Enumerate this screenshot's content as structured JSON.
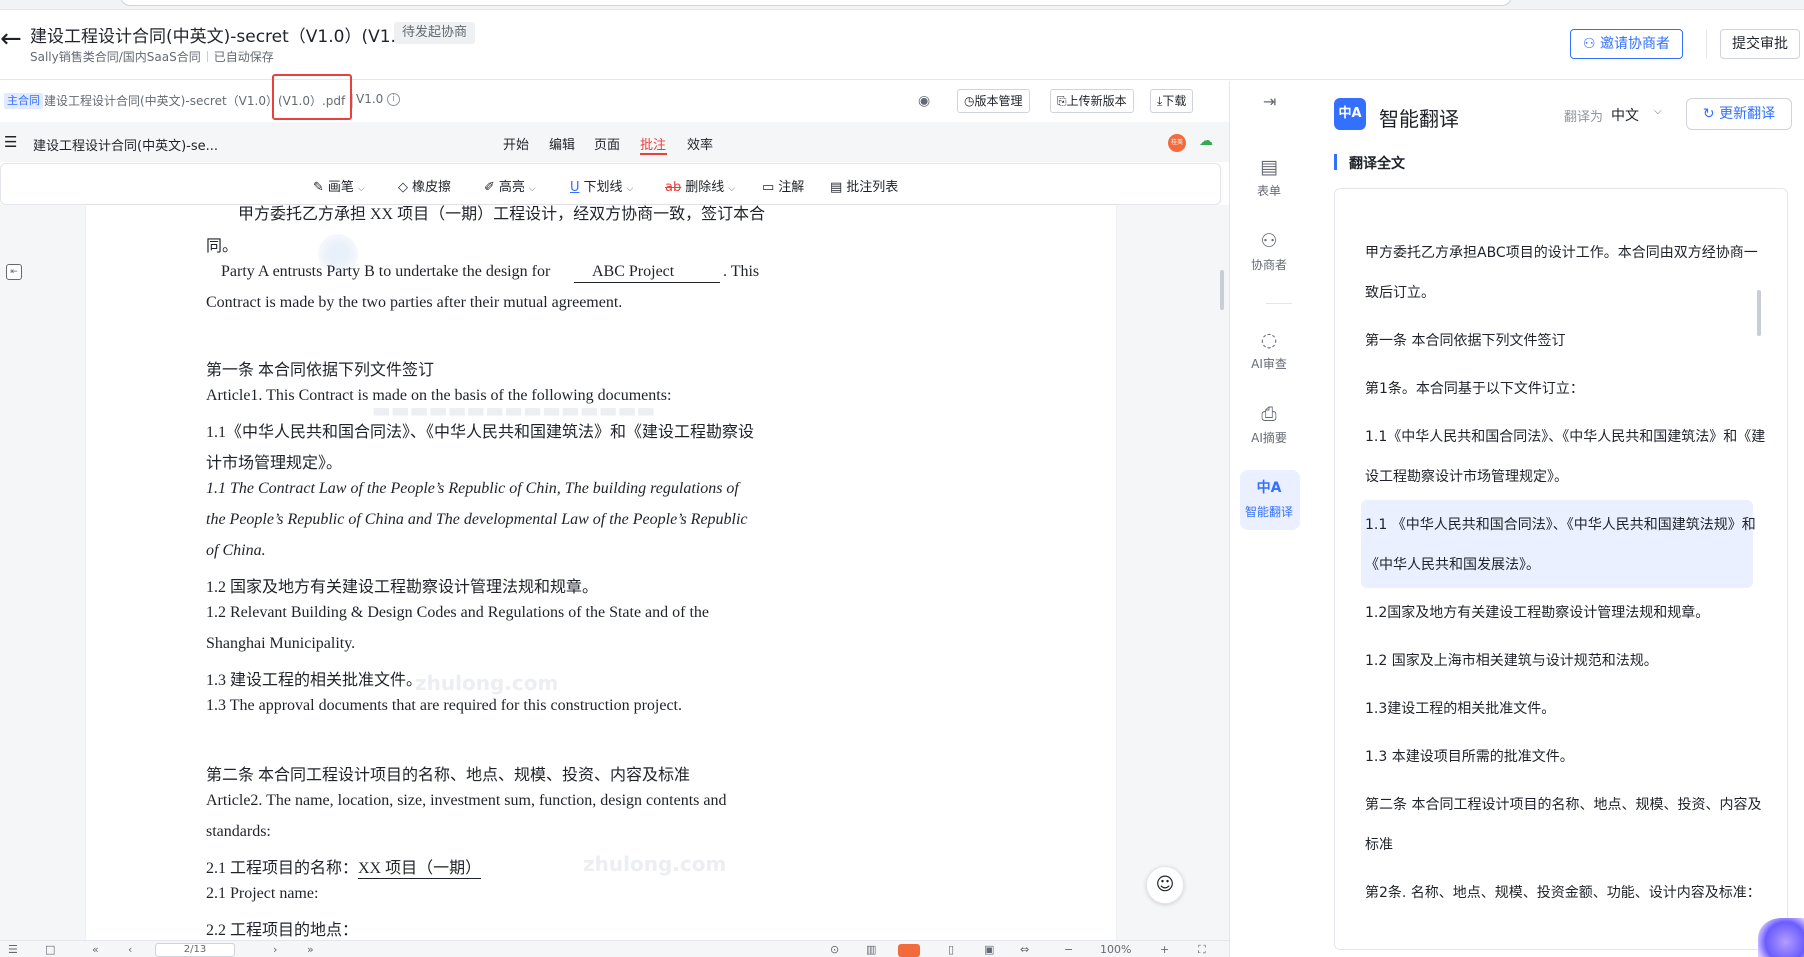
{
  "header": {
    "back_icon": "←",
    "title": "建设工程设计合同(中英文)-secret（V1.0）(V1.0)",
    "status_tag": "待发起协商",
    "breadcrumb": "Sally销售类合同/国内SaaS合同",
    "autosave": "已自动保存",
    "invite_button": "邀请协商者",
    "submit_button": "提交审批"
  },
  "file_bar": {
    "main_badge": "主合同",
    "file_name": "建设工程设计合同(中英文)-secret（V1.0）",
    "file_suffix": "(V1.0）.pdf",
    "version": "V1.0",
    "version_mgmt": "版本管理",
    "upload_new": "上传新版本",
    "download": "下载"
  },
  "menubar": {
    "doc_title": "建设工程设计合同(中英文)-se...",
    "tabs": [
      "开始",
      "编辑",
      "页面",
      "批注",
      "效率"
    ],
    "active_tab": "批注",
    "avatar_text": "桂英"
  },
  "annotation_tools": {
    "pen": "画笔",
    "eraser": "橡皮擦",
    "highlight": "高亮",
    "underline": "下划线",
    "strikeout": "删除线",
    "note": "注解",
    "comment_list": "批注列表"
  },
  "document": {
    "lines": [
      "甲方委托乙方承担 XX 项目（一期）工程设计，经双方协商一致，签订本合",
      "同。",
      "Party A entrusts Party B to undertake the design for",
      "ABC Project",
      ". This",
      "Contract is made by the two parties after their mutual agreement.",
      "第一条    本合同依据下列文件签订",
      "Article1. This Contract is made on the basis of the following documents:",
      "1.1《中华人民共和国合同法》、《中华人民共和国建筑法》和《建设工程勘察设",
      "计市场管理规定》。",
      "1.1 The Contract Law of the People’s Republic of Chin, The building regulations of",
      "the People’s Republic of China and The developmental Law of the People’s Republic",
      "of China.",
      "1.2 国家及地方有关建设工程勘察设计管理法规和规章。",
      "1.2 Relevant Building & Design Codes and Regulations of the State and of the",
      "Shanghai Municipality.",
      "1.3 建设工程的相关批准文件。",
      "1.3 The approval documents that are required for this construction project.",
      "第二条    本合同工程设计项目的名称、地点、规模、投资、内容及标准",
      "Article2. The name, location, size, investment sum, function, design contents and",
      "standards:",
      "2.1 工程项目的名称：",
      "XX 项目（一期）",
      "2.1 Project name:",
      "2.2 工程项目的地点："
    ],
    "watermark": "zhulong.com"
  },
  "bottom_bar": {
    "page": "2/13",
    "zoom": "100%"
  },
  "rail": {
    "items": [
      {
        "label": "表单",
        "icon": "form-icon"
      },
      {
        "label": "协商者",
        "icon": "users-icon"
      },
      {
        "label": "AI审查",
        "icon": "ai-review-icon"
      },
      {
        "label": "AI摘要",
        "icon": "ai-summary-icon"
      },
      {
        "label": "智能翻译",
        "icon": "translate-icon"
      }
    ],
    "active": "智能翻译"
  },
  "panel": {
    "logo_text": "中A",
    "title": "智能翻译",
    "translate_to_label": "翻译为",
    "language": "中文",
    "update_button": "更新翻译",
    "section_title": "翻译全文",
    "lines": [
      "甲方委托乙方承担ABC项目的设计工作。本合同由双方经协商一",
      "致后订立。",
      "第一条 本合同依据下列文件签订",
      "第1条。本合同基于以下文件订立：",
      "1.1《中华人民共和国合同法》、《中华人民共和国建筑法》和《建",
      "设工程勘察设计市场管理规定》。",
      "1.1 《中华人民共和国合同法》、《中华人民共和国建筑法规》和",
      "《中华人民共和国发展法》。",
      "1.2国家及地方有关建设工程勘察设计管理法规和规章。",
      "1.2 国家及上海市相关建筑与设计规范和法规。",
      "1.3建设工程的相关批准文件。",
      "1.3 本建设项目所需的批准文件。",
      "第二条 本合同工程设计项目的名称、地点、规模、投资、内容及",
      "标准",
      "第2条. 名称、地点、规模、投资金额、功能、设计内容及标准："
    ]
  },
  "colors": {
    "accent": "#3370ff",
    "active_tab": "#e8403c",
    "highlight_box": "#e8403c",
    "highlight_row": "#eaf0ff"
  }
}
